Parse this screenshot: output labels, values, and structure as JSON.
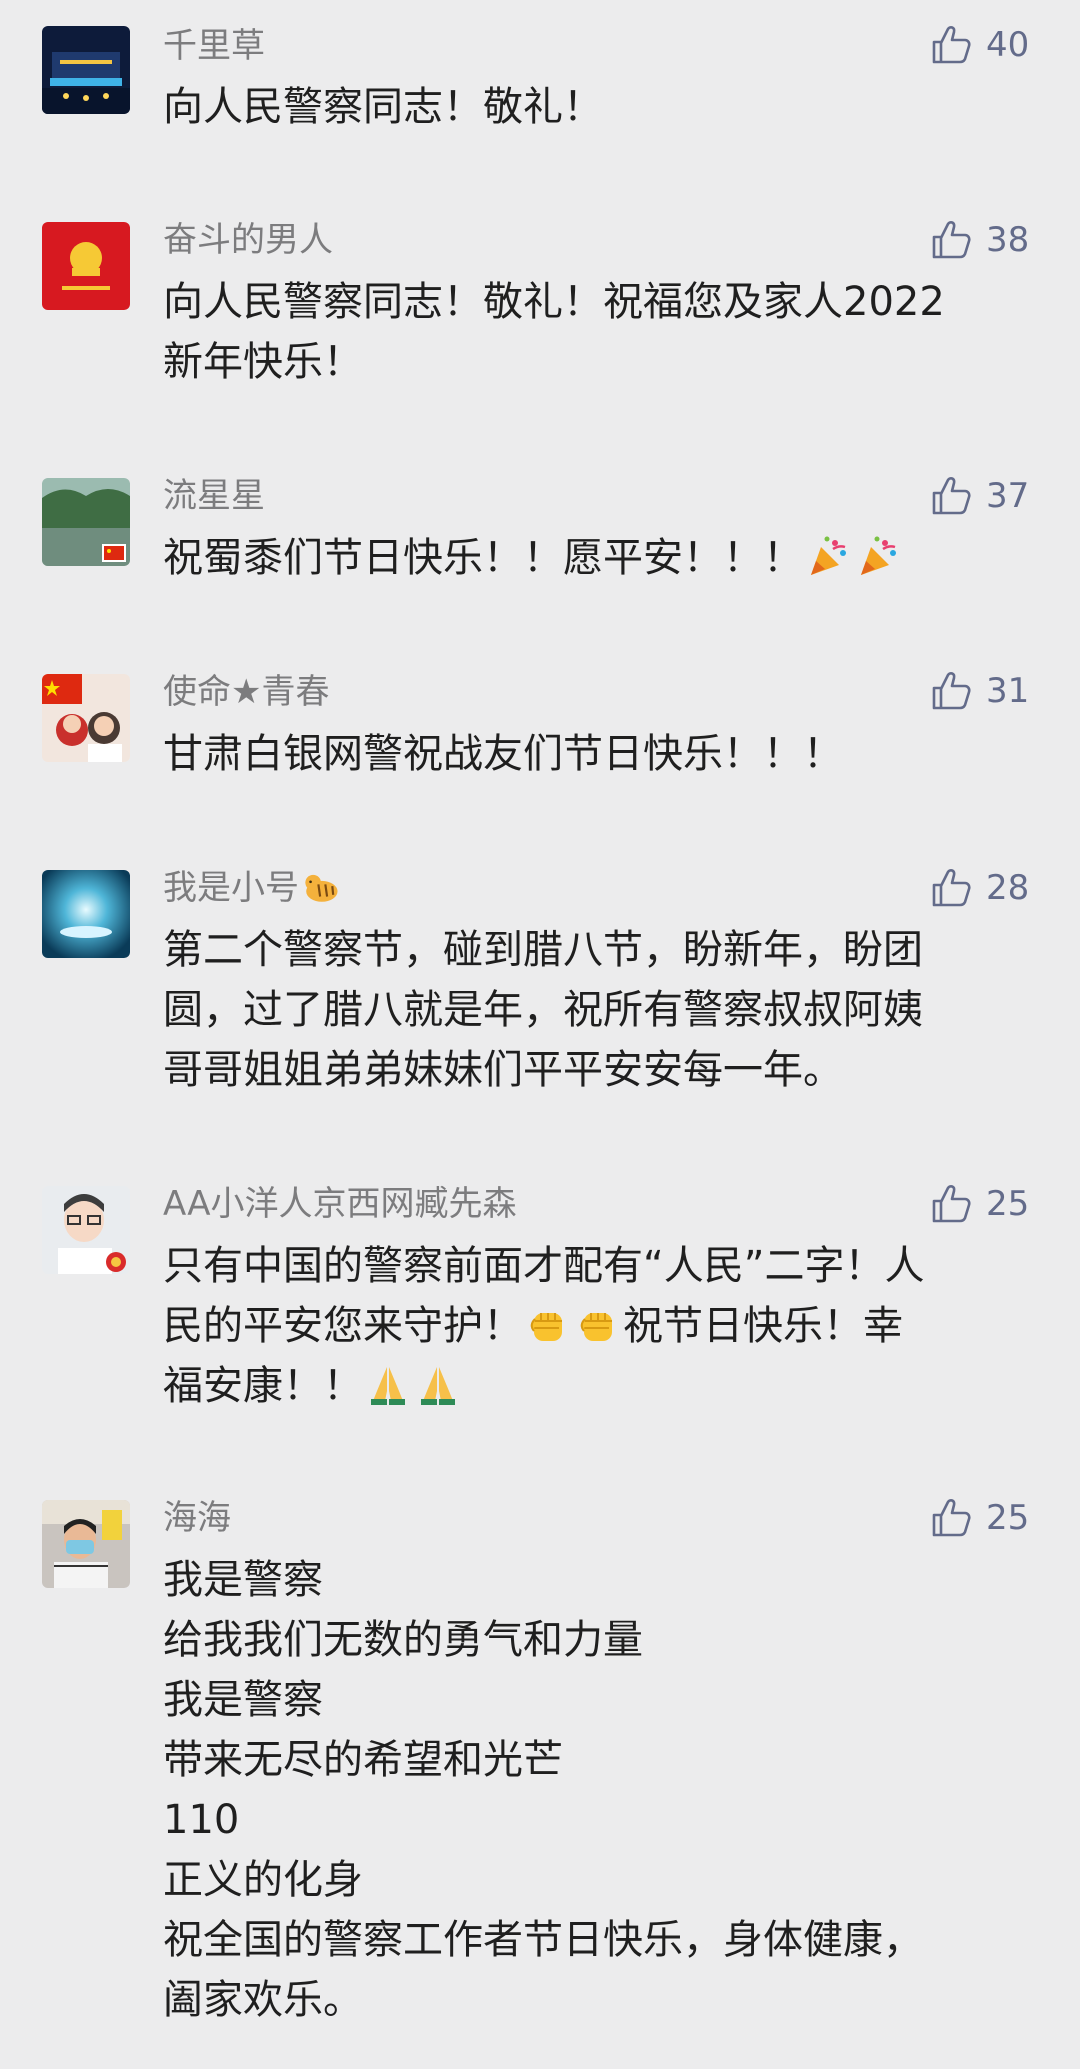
{
  "comments": [
    {
      "name": "千里草",
      "likes": "40",
      "text": "向人民警察同志！敬礼！"
    },
    {
      "name": "奋斗的男人",
      "likes": "38",
      "text": "向人民警察同志！敬礼！祝福您及家人2022\n新年快乐！"
    },
    {
      "name": "流星星",
      "likes": "37",
      "text": "祝蜀黍们节日快乐！！愿平安！！！"
    },
    {
      "name": "使命★青春",
      "likes": "31",
      "text": "甘肃白银网警祝战友们节日快乐！！！"
    },
    {
      "name": "我是小号",
      "likes": "28",
      "text": "第二个警察节，碰到腊八节，盼新年，盼团\n圆，过了腊八就是年，祝所有警察叔叔阿姨\n哥哥姐姐弟弟妹妹们平平安安每一年。"
    },
    {
      "name": "AA小洋人京西网臧先森",
      "likes": "25",
      "text_1": "只有中国的警察前面才配有“人民”二字！人\n民的平安您来守护！",
      "text_2": "祝节日快乐！幸\n福安康！！"
    },
    {
      "name": "海海",
      "likes": "25",
      "text": "我是警察\n给我我们无数的勇气和力量\n我是警察\n带来无尽的希望和光芒\n110\n正义的化身\n祝全国的警察工作者节日快乐，身体健康，\n阖家欢乐。"
    }
  ],
  "icons": {
    "like": "thumbs-up-outline-icon",
    "party": "party-popper-emoji",
    "fist": "raised-fist-emoji",
    "pray": "folded-hands-emoji",
    "tiger": "tiger-emoji"
  },
  "colors": {
    "background": "#ececed",
    "name": "#7c7c7e",
    "like": "#636b8a",
    "text": "#1f1f1f"
  }
}
